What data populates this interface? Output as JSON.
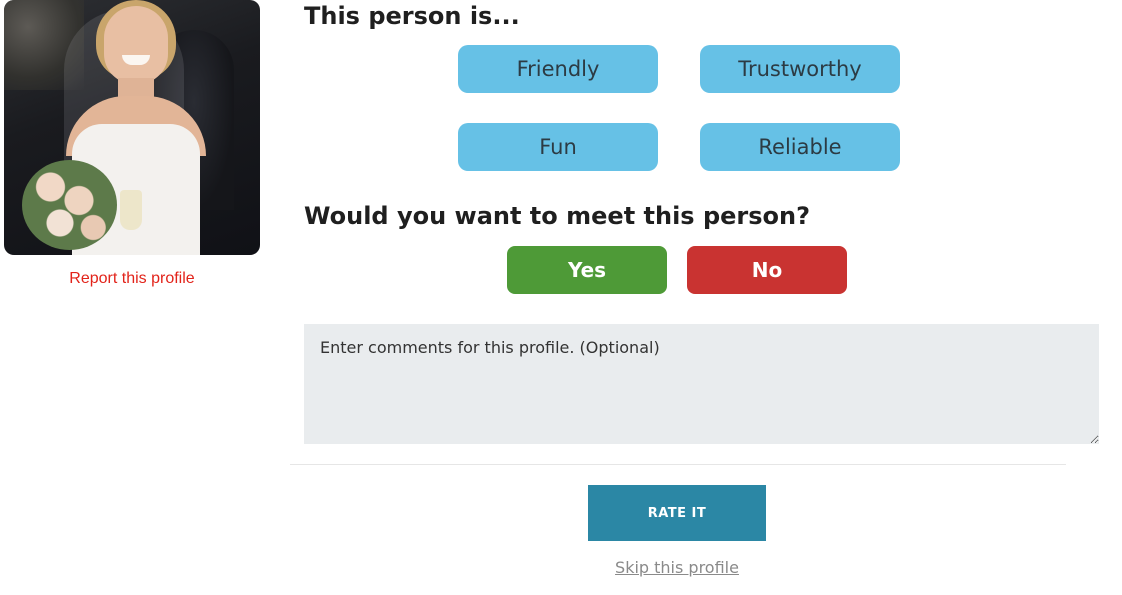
{
  "profile": {
    "photo_alt": "profile-photo",
    "report_label": "Report this profile"
  },
  "traits": {
    "heading": "This person is...",
    "options": [
      "Friendly",
      "Trustworthy",
      "Fun",
      "Reliable"
    ]
  },
  "meet": {
    "heading": "Would you want to meet this person?",
    "yes_label": "Yes",
    "no_label": "No"
  },
  "comments": {
    "placeholder": "Enter comments for this profile. (Optional)",
    "value": ""
  },
  "actions": {
    "rate_label": "RATE IT",
    "skip_label": "Skip this profile"
  },
  "colors": {
    "trait_button": "#66c1e6",
    "yes_button": "#4e9a37",
    "no_button": "#c93331",
    "rate_button": "#2b87a5",
    "report_link": "#e2231a"
  }
}
